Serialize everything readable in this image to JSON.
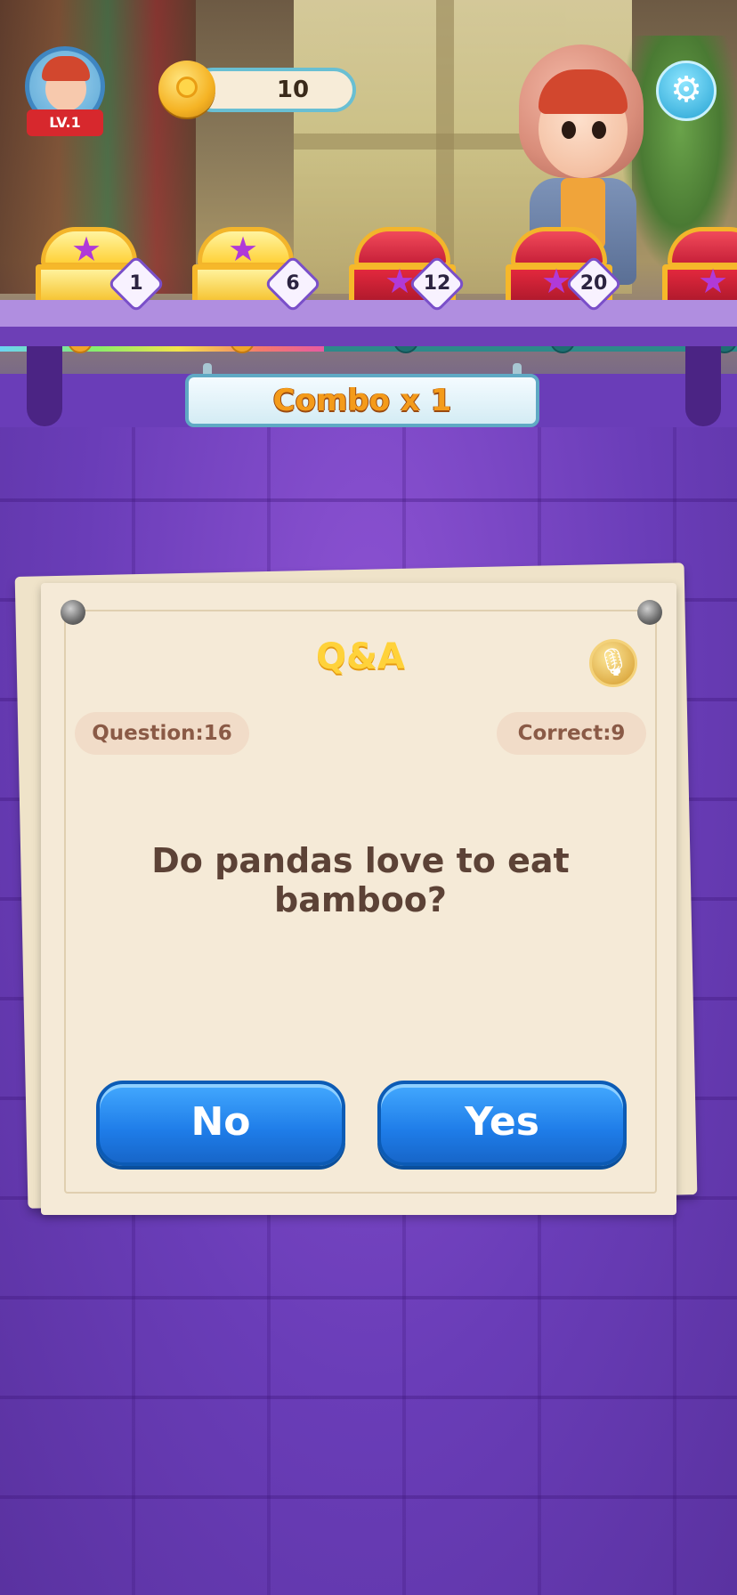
{
  "player": {
    "level": "LV.1"
  },
  "coins": {
    "value": "10"
  },
  "rewards": {
    "chests": [
      {
        "label": "1",
        "opened": true
      },
      {
        "label": "6",
        "opened": true
      },
      {
        "label": "12",
        "opened": false
      },
      {
        "label": "20",
        "opened": false
      }
    ],
    "progress_fraction": 0.44
  },
  "combo": {
    "label": "Combo x 1"
  },
  "quiz": {
    "title": "Q&A",
    "question_counter": "Question:16",
    "correct_counter": "Correct:9",
    "question_text": "Do pandas love to eat bamboo?",
    "answers": {
      "no": "No",
      "yes": "Yes"
    }
  },
  "icons": {
    "settings": "gear-icon",
    "microphone": "microphone-icon",
    "coin": "coin-icon"
  },
  "colors": {
    "button_blue": "#1e7ce8",
    "combo_text": "#f49b1a",
    "qa_title": "#ffd23a",
    "wall_purple": "#6a3db8"
  }
}
